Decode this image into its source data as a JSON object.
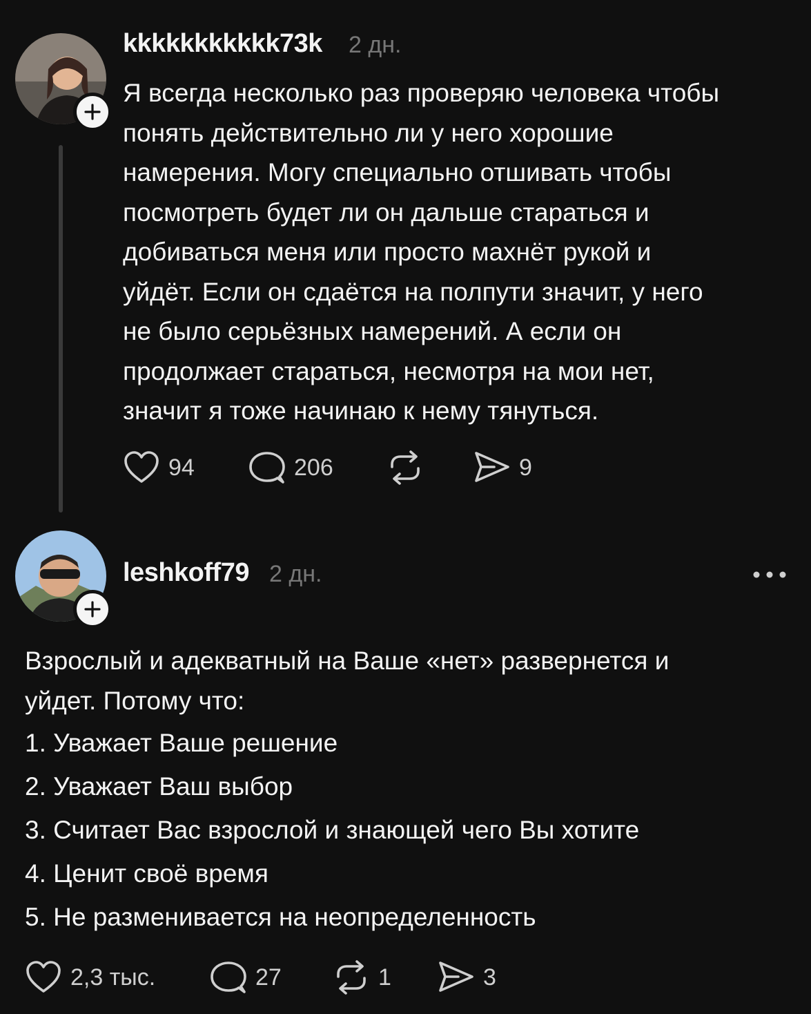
{
  "posts": [
    {
      "username": "kkkkkkkkkkk73k",
      "time": "2 дн.",
      "text_lines": [
        "Я всегда несколько раз проверяю человека чтобы",
        "понять действительно ли у него хорошие",
        "намерения. Могу специально отшивать чтобы",
        "посмотреть будет ли он дальше стараться и",
        "добиваться меня или просто махнёт рукой и",
        "уйдёт. Если он сдаётся на полпути значит, у него",
        "не было серьёзных намерений. А если он",
        "продолжает стараться, несмотря на мои нет,",
        "значит я тоже начинаю к нему тянуться."
      ],
      "likes": "94",
      "comments": "206",
      "reposts": "",
      "shares": "9"
    },
    {
      "username": "leshkoff79",
      "time": "2 дн.",
      "text_lines": [
        "Взрослый и адекватный на Ваше «нет» развернется и",
        "уйдет. Потому что:"
      ],
      "list_items": [
        "1. Уважает Ваше решение",
        "2. Уважает Ваш выбор",
        "3. Считает Вас взрослой и знающей чего Вы хотите",
        "4. Ценит своё время",
        "5. Не разменивается на неопределенность"
      ],
      "likes": "2,3 тыс.",
      "comments": "27",
      "reposts": "1",
      "shares": "3"
    }
  ],
  "icons": {
    "like": "heart-icon",
    "comment": "comment-bubble-icon",
    "repost": "repost-icon",
    "share": "send-icon",
    "follow": "plus-icon",
    "more": "more-dots-icon"
  },
  "colors": {
    "background": "#101010",
    "text": "#f3f3f3",
    "muted": "#777777",
    "thread_line": "#3a3a3a"
  }
}
